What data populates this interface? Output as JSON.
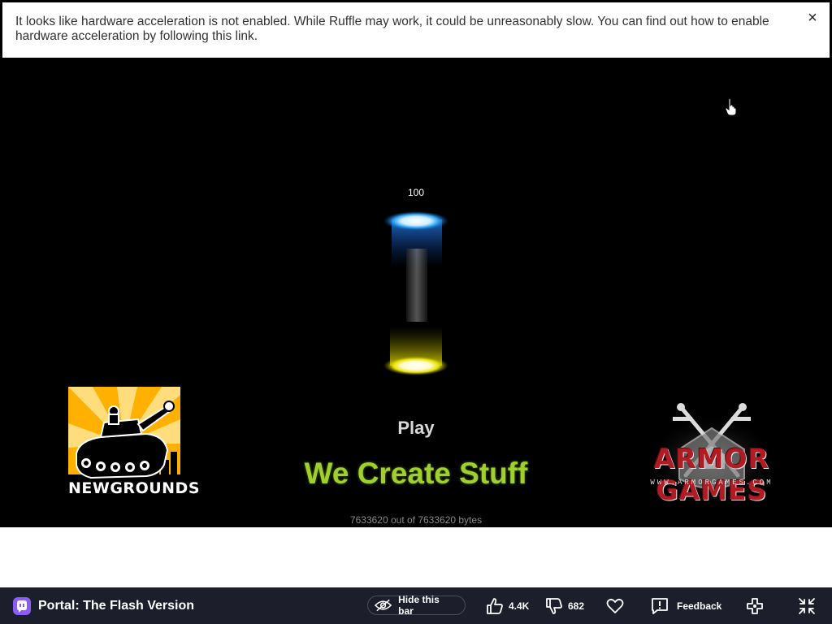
{
  "notice": {
    "message": "It looks like hardware acceleration is not enabled. While Ruffle may work, it could be unreasonably slow. You can find out how to enable hardware acceleration by following this link.",
    "close_label": "×"
  },
  "game": {
    "progress_count": "100",
    "play_label": "Play",
    "tagline": "We Create Stuff",
    "bytes_status": "7633620 out of 7633620 bytes",
    "newgrounds_wordmark": "NEWGROUNDS",
    "armor_wordmark": "ARMOR GAMES",
    "armor_url": "WWW.ARMORGAMES.COM",
    "tagline_color": "#9fd02e"
  },
  "bottom_bar": {
    "title": "Portal: The Flash Version",
    "hide_bar_label": "Hide this bar",
    "like_count": "4.4K",
    "dislike_count": "682",
    "feedback_label": "Feedback",
    "background_color": "#1c1e2b",
    "icons": [
      "site-logo-icon",
      "eye-off-icon",
      "thumbs-up-icon",
      "thumbs-down-icon",
      "heart-icon",
      "feedback-icon",
      "controller-icon",
      "exit-fullscreen-icon"
    ]
  }
}
